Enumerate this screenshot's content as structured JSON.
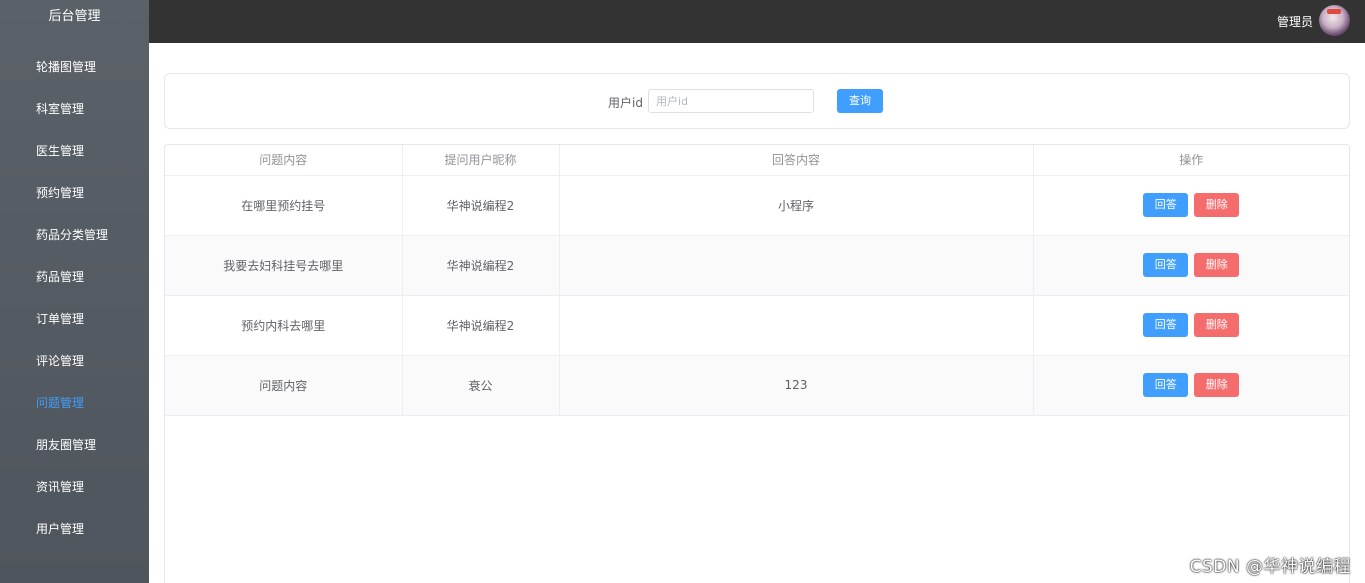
{
  "sidebar": {
    "title": "后台管理",
    "items": [
      {
        "label": "轮播图管理"
      },
      {
        "label": "科室管理"
      },
      {
        "label": "医生管理"
      },
      {
        "label": "预约管理"
      },
      {
        "label": "药品分类管理"
      },
      {
        "label": "药品管理"
      },
      {
        "label": "订单管理"
      },
      {
        "label": "评论管理"
      },
      {
        "label": "问题管理",
        "active": true
      },
      {
        "label": "朋友圈管理"
      },
      {
        "label": "资讯管理"
      },
      {
        "label": "用户管理"
      }
    ]
  },
  "header": {
    "admin_name": "管理员"
  },
  "search": {
    "label": "用户id",
    "placeholder": "用户id",
    "value": "",
    "button_label": "查询"
  },
  "table": {
    "columns": [
      "问题内容",
      "提问用户昵称",
      "回答内容",
      "操作"
    ],
    "rows": [
      {
        "question": "在哪里预约挂号",
        "nickname": "华神说编程2",
        "answer": "小程序",
        "answer_btn": "回答",
        "delete_btn": "删除"
      },
      {
        "question": "我要去妇科挂号去哪里",
        "nickname": "华神说编程2",
        "answer": "",
        "answer_btn": "回答",
        "delete_btn": "删除"
      },
      {
        "question": "预约内科去哪里",
        "nickname": "华神说编程2",
        "answer": "",
        "answer_btn": "回答",
        "delete_btn": "删除"
      },
      {
        "question": "问题内容",
        "nickname": "衰公",
        "answer": "123",
        "answer_btn": "回答",
        "delete_btn": "删除"
      }
    ]
  },
  "watermark": "CSDN @华神说编程",
  "colors": {
    "sidebar_bg": "#535960",
    "topbar_bg": "#333333",
    "accent": "#409eff",
    "danger": "#f56c6c"
  }
}
